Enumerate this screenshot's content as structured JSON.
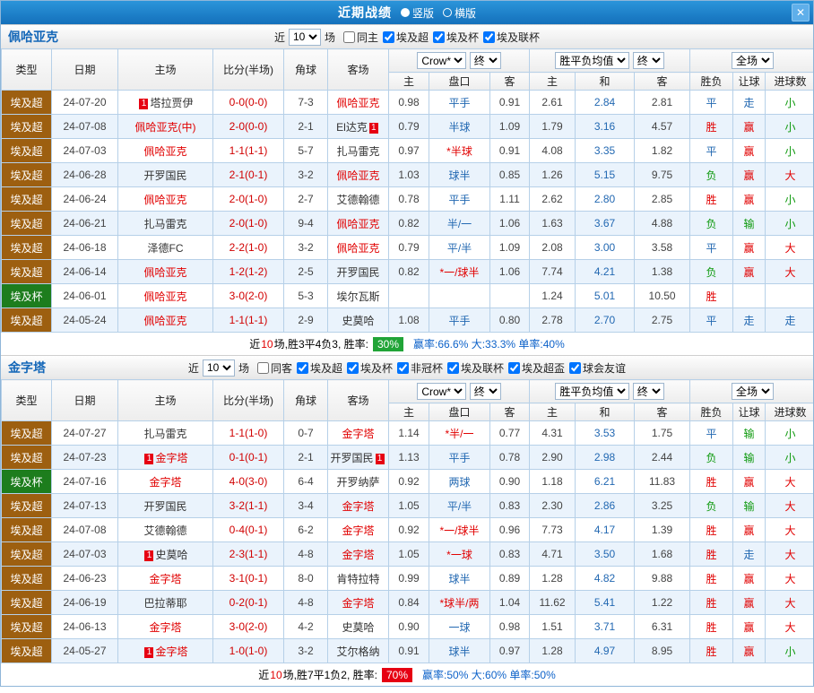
{
  "titlebar": {
    "title": "近期战绩",
    "layout_options": [
      {
        "label": "竖版",
        "selected": true
      },
      {
        "label": "横版",
        "selected": false
      }
    ],
    "close_icon": "✕"
  },
  "colors": {
    "titlebar": "#1470bb",
    "titlebar_light": "#2b95da",
    "league_super": "#9d5f10",
    "league_cup": "#1d7d1d",
    "win_red": "#e10000",
    "lose_green": "#0d990d",
    "draw_blue": "#2268b2",
    "score_red": "#d10000",
    "badge_green": "#21a437",
    "badge_red": "#e60012",
    "row_alt": "#eaf3fc",
    "grid_border": "#b6d0e8"
  },
  "columns_sub": [
    "主",
    "盘口",
    "客",
    "主",
    "和",
    "客",
    "胜负",
    "让球",
    "进球数"
  ],
  "sections": [
    {
      "team": "佩哈亚克",
      "filters": {
        "near": "近",
        "rounds": "10",
        "unit": "场",
        "checkboxes": [
          {
            "label": "同主",
            "checked": false
          },
          {
            "label": "埃及超",
            "checked": true
          },
          {
            "label": "埃及杯",
            "checked": true
          },
          {
            "label": "埃及联杯",
            "checked": true
          }
        ]
      },
      "header": {
        "type": "类型",
        "date": "日期",
        "home": "主场",
        "score": "比分(半场)",
        "corners": "角球",
        "away": "客场",
        "odds_source": "Crow*",
        "odds_stage": "终",
        "europe": "胜平负均值",
        "europe_stage": "终",
        "scope": "全场"
      },
      "rows": [
        {
          "league": "埃及超",
          "league_style": "super",
          "date": "24-07-20",
          "home": {
            "name": "塔拉贾伊",
            "badge_left": "1"
          },
          "score": "0-0(0-0)",
          "corners": "7-3",
          "away": {
            "name": "佩哈亚克",
            "highlight": true
          },
          "asian": [
            "0.98",
            "平手",
            "0.91"
          ],
          "europe": [
            "2.61",
            "2.84",
            "2.81"
          ],
          "result": [
            "平",
            "blue"
          ],
          "handicap_result": [
            "走",
            "blue"
          ],
          "goals_result": [
            "小",
            "green"
          ]
        },
        {
          "league": "埃及超",
          "league_style": "super",
          "date": "24-07-08",
          "home": {
            "name": "佩哈亚克(中)",
            "highlight": true
          },
          "score": "2-0(0-0)",
          "corners": "2-1",
          "away": {
            "name": "El达克",
            "badge_right": "1"
          },
          "asian": [
            "0.79",
            "半球",
            "1.09"
          ],
          "europe": [
            "1.79",
            "3.16",
            "4.57"
          ],
          "result": [
            "胜",
            "red"
          ],
          "handicap_result": [
            "赢",
            "red"
          ],
          "goals_result": [
            "小",
            "green"
          ]
        },
        {
          "league": "埃及超",
          "league_style": "super",
          "date": "24-07-03",
          "home": {
            "name": "佩哈亚克",
            "highlight": true
          },
          "score": "1-1(1-1)",
          "corners": "5-7",
          "away": {
            "name": "扎马雷克"
          },
          "asian": [
            "0.97",
            "*半球",
            "0.91"
          ],
          "europe": [
            "4.08",
            "3.35",
            "1.82"
          ],
          "result": [
            "平",
            "blue"
          ],
          "handicap_result": [
            "赢",
            "red"
          ],
          "goals_result": [
            "小",
            "green"
          ]
        },
        {
          "league": "埃及超",
          "league_style": "super",
          "date": "24-06-28",
          "home": {
            "name": "开罗国民"
          },
          "score": "2-1(0-1)",
          "corners": "3-2",
          "away": {
            "name": "佩哈亚克",
            "highlight": true
          },
          "asian": [
            "1.03",
            "球半",
            "0.85"
          ],
          "europe": [
            "1.26",
            "5.15",
            "9.75"
          ],
          "result": [
            "负",
            "green"
          ],
          "handicap_result": [
            "赢",
            "red"
          ],
          "goals_result": [
            "大",
            "red"
          ]
        },
        {
          "league": "埃及超",
          "league_style": "super",
          "date": "24-06-24",
          "home": {
            "name": "佩哈亚克",
            "highlight": true
          },
          "score": "2-0(1-0)",
          "corners": "2-7",
          "away": {
            "name": "艾德翰德"
          },
          "asian": [
            "0.78",
            "平手",
            "1.11"
          ],
          "europe": [
            "2.62",
            "2.80",
            "2.85"
          ],
          "result": [
            "胜",
            "red"
          ],
          "handicap_result": [
            "赢",
            "red"
          ],
          "goals_result": [
            "小",
            "green"
          ]
        },
        {
          "league": "埃及超",
          "league_style": "super",
          "date": "24-06-21",
          "home": {
            "name": "扎马雷克"
          },
          "score": "2-0(1-0)",
          "corners": "9-4",
          "away": {
            "name": "佩哈亚克",
            "highlight": true
          },
          "asian": [
            "0.82",
            "半/一",
            "1.06"
          ],
          "europe": [
            "1.63",
            "3.67",
            "4.88"
          ],
          "result": [
            "负",
            "green"
          ],
          "handicap_result": [
            "输",
            "green"
          ],
          "goals_result": [
            "小",
            "green"
          ]
        },
        {
          "league": "埃及超",
          "league_style": "super",
          "date": "24-06-18",
          "home": {
            "name": "泽德FC"
          },
          "score": "2-2(1-0)",
          "corners": "3-2",
          "away": {
            "name": "佩哈亚克",
            "highlight": true
          },
          "asian": [
            "0.79",
            "平/半",
            "1.09"
          ],
          "europe": [
            "2.08",
            "3.00",
            "3.58"
          ],
          "result": [
            "平",
            "blue"
          ],
          "handicap_result": [
            "赢",
            "red"
          ],
          "goals_result": [
            "大",
            "red"
          ]
        },
        {
          "league": "埃及超",
          "league_style": "super",
          "date": "24-06-14",
          "home": {
            "name": "佩哈亚克",
            "highlight": true
          },
          "score": "1-2(1-2)",
          "corners": "2-5",
          "away": {
            "name": "开罗国民"
          },
          "asian": [
            "0.82",
            "*一/球半",
            "1.06"
          ],
          "europe": [
            "7.74",
            "4.21",
            "1.38"
          ],
          "result": [
            "负",
            "green"
          ],
          "handicap_result": [
            "赢",
            "red"
          ],
          "goals_result": [
            "大",
            "red"
          ]
        },
        {
          "league": "埃及杯",
          "league_style": "cup",
          "date": "24-06-01",
          "home": {
            "name": "佩哈亚克",
            "highlight": true
          },
          "score": "3-0(2-0)",
          "corners": "5-3",
          "away": {
            "name": "埃尔瓦斯"
          },
          "asian": [
            "",
            "",
            ""
          ],
          "europe": [
            "1.24",
            "5.01",
            "10.50"
          ],
          "result": [
            "胜",
            "red"
          ],
          "handicap_result": [
            "",
            ""
          ],
          "goals_result": [
            "",
            ""
          ]
        },
        {
          "league": "埃及超",
          "league_style": "super",
          "date": "24-05-24",
          "home": {
            "name": "佩哈亚克",
            "highlight": true
          },
          "score": "1-1(1-1)",
          "corners": "2-9",
          "away": {
            "name": "史莫哈"
          },
          "asian": [
            "1.08",
            "平手",
            "0.80"
          ],
          "europe": [
            "2.78",
            "2.70",
            "2.75"
          ],
          "result": [
            "平",
            "blue"
          ],
          "handicap_result": [
            "走",
            "blue"
          ],
          "goals_result": [
            "走",
            "blue"
          ]
        }
      ],
      "summary": {
        "lead": "近",
        "count": "10",
        "text": "场,胜3平4负3, 胜率:",
        "rate": "30%",
        "rate_style": "green",
        "stats": "赢率:66.6% 大:33.3% 单率:40%"
      }
    },
    {
      "team": "金字塔",
      "filters": {
        "near": "近",
        "rounds": "10",
        "unit": "场",
        "checkboxes": [
          {
            "label": "同客",
            "checked": false
          },
          {
            "label": "埃及超",
            "checked": true
          },
          {
            "label": "埃及杯",
            "checked": true
          },
          {
            "label": "非冠杯",
            "checked": true
          },
          {
            "label": "埃及联杯",
            "checked": true
          },
          {
            "label": "埃及超盃",
            "checked": true
          },
          {
            "label": "球会友谊",
            "checked": true
          }
        ]
      },
      "header": {
        "type": "类型",
        "date": "日期",
        "home": "主场",
        "score": "比分(半场)",
        "corners": "角球",
        "away": "客场",
        "odds_source": "Crow*",
        "odds_stage": "终",
        "europe": "胜平负均值",
        "europe_stage": "终",
        "scope": "全场"
      },
      "rows": [
        {
          "league": "埃及超",
          "league_style": "super",
          "date": "24-07-27",
          "home": {
            "name": "扎马雷克"
          },
          "score": "1-1(1-0)",
          "corners": "0-7",
          "away": {
            "name": "金字塔",
            "highlight": true
          },
          "asian": [
            "1.14",
            "*半/一",
            "0.77"
          ],
          "europe": [
            "4.31",
            "3.53",
            "1.75"
          ],
          "result": [
            "平",
            "blue"
          ],
          "handicap_result": [
            "输",
            "green"
          ],
          "goals_result": [
            "小",
            "green"
          ]
        },
        {
          "league": "埃及超",
          "league_style": "super",
          "date": "24-07-23",
          "home": {
            "name": "金字塔",
            "highlight": true,
            "badge_left": "1"
          },
          "score": "0-1(0-1)",
          "corners": "2-1",
          "away": {
            "name": "开罗国民",
            "badge_right": "1"
          },
          "asian": [
            "1.13",
            "平手",
            "0.78"
          ],
          "europe": [
            "2.90",
            "2.98",
            "2.44"
          ],
          "result": [
            "负",
            "green"
          ],
          "handicap_result": [
            "输",
            "green"
          ],
          "goals_result": [
            "小",
            "green"
          ]
        },
        {
          "league": "埃及杯",
          "league_style": "cup",
          "date": "24-07-16",
          "home": {
            "name": "金字塔",
            "highlight": true
          },
          "score": "4-0(3-0)",
          "corners": "6-4",
          "away": {
            "name": "开罗纳萨"
          },
          "asian": [
            "0.92",
            "两球",
            "0.90"
          ],
          "europe": [
            "1.18",
            "6.21",
            "11.83"
          ],
          "result": [
            "胜",
            "red"
          ],
          "handicap_result": [
            "赢",
            "red"
          ],
          "goals_result": [
            "大",
            "red"
          ]
        },
        {
          "league": "埃及超",
          "league_style": "super",
          "date": "24-07-13",
          "home": {
            "name": "开罗国民"
          },
          "score": "3-2(1-1)",
          "corners": "3-4",
          "away": {
            "name": "金字塔",
            "highlight": true
          },
          "asian": [
            "1.05",
            "平/半",
            "0.83"
          ],
          "europe": [
            "2.30",
            "2.86",
            "3.25"
          ],
          "result": [
            "负",
            "green"
          ],
          "handicap_result": [
            "输",
            "green"
          ],
          "goals_result": [
            "大",
            "red"
          ]
        },
        {
          "league": "埃及超",
          "league_style": "super",
          "date": "24-07-08",
          "home": {
            "name": "艾德翰德"
          },
          "score": "0-4(0-1)",
          "corners": "6-2",
          "away": {
            "name": "金字塔",
            "highlight": true
          },
          "asian": [
            "0.92",
            "*一/球半",
            "0.96"
          ],
          "europe": [
            "7.73",
            "4.17",
            "1.39"
          ],
          "result": [
            "胜",
            "red"
          ],
          "handicap_result": [
            "赢",
            "red"
          ],
          "goals_result": [
            "大",
            "red"
          ]
        },
        {
          "league": "埃及超",
          "league_style": "super",
          "date": "24-07-03",
          "home": {
            "name": "史莫哈",
            "badge_left": "1"
          },
          "score": "2-3(1-1)",
          "corners": "4-8",
          "away": {
            "name": "金字塔",
            "highlight": true
          },
          "asian": [
            "1.05",
            "*一球",
            "0.83"
          ],
          "europe": [
            "4.71",
            "3.50",
            "1.68"
          ],
          "result": [
            "胜",
            "red"
          ],
          "handicap_result": [
            "走",
            "blue"
          ],
          "goals_result": [
            "大",
            "red"
          ]
        },
        {
          "league": "埃及超",
          "league_style": "super",
          "date": "24-06-23",
          "home": {
            "name": "金字塔",
            "highlight": true
          },
          "score": "3-1(0-1)",
          "corners": "8-0",
          "away": {
            "name": "肯特拉特"
          },
          "asian": [
            "0.99",
            "球半",
            "0.89"
          ],
          "europe": [
            "1.28",
            "4.82",
            "9.88"
          ],
          "result": [
            "胜",
            "red"
          ],
          "handicap_result": [
            "赢",
            "red"
          ],
          "goals_result": [
            "大",
            "red"
          ]
        },
        {
          "league": "埃及超",
          "league_style": "super",
          "date": "24-06-19",
          "home": {
            "name": "巴拉蒂耶"
          },
          "score": "0-2(0-1)",
          "corners": "4-8",
          "away": {
            "name": "金字塔",
            "highlight": true
          },
          "asian": [
            "0.84",
            "*球半/两",
            "1.04"
          ],
          "europe": [
            "11.62",
            "5.41",
            "1.22"
          ],
          "result": [
            "胜",
            "red"
          ],
          "handicap_result": [
            "赢",
            "red"
          ],
          "goals_result": [
            "大",
            "red"
          ]
        },
        {
          "league": "埃及超",
          "league_style": "super",
          "date": "24-06-13",
          "home": {
            "name": "金字塔",
            "highlight": true
          },
          "score": "3-0(2-0)",
          "corners": "4-2",
          "away": {
            "name": "史莫哈"
          },
          "asian": [
            "0.90",
            "一球",
            "0.98"
          ],
          "europe": [
            "1.51",
            "3.71",
            "6.31"
          ],
          "result": [
            "胜",
            "red"
          ],
          "handicap_result": [
            "赢",
            "red"
          ],
          "goals_result": [
            "大",
            "red"
          ]
        },
        {
          "league": "埃及超",
          "league_style": "super",
          "date": "24-05-27",
          "home": {
            "name": "金字塔",
            "highlight": true,
            "badge_left": "1"
          },
          "score": "1-0(1-0)",
          "corners": "3-2",
          "away": {
            "name": "艾尔格纳"
          },
          "asian": [
            "0.91",
            "球半",
            "0.97"
          ],
          "europe": [
            "1.28",
            "4.97",
            "8.95"
          ],
          "result": [
            "胜",
            "red"
          ],
          "handicap_result": [
            "赢",
            "red"
          ],
          "goals_result": [
            "小",
            "green"
          ]
        }
      ],
      "summary": {
        "lead": "近",
        "count": "10",
        "text": "场,胜7平1负2, 胜率:",
        "rate": "70%",
        "rate_style": "red",
        "stats": "赢率:50% 大:60% 单率:50%"
      }
    }
  ]
}
